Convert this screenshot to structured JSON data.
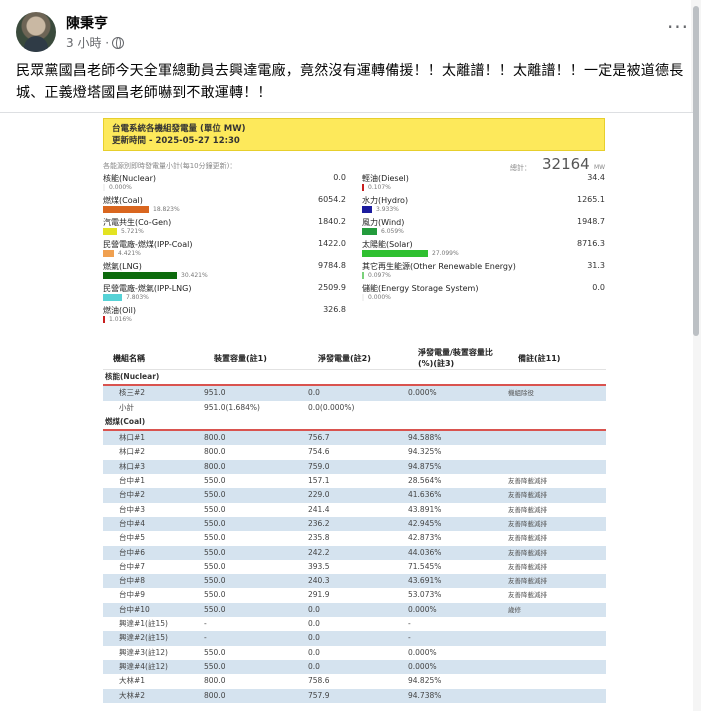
{
  "post": {
    "author": "陳秉亨",
    "time": "3 小時 ·",
    "more": "···",
    "text": "民眾黨國昌老師今天全軍總動員去興達電廠，竟然沒有運轉備援！！太離譜！！太離譜！！一定是被道德長城、正義燈塔國昌老師嚇到不敢運轉！！"
  },
  "report": {
    "title": "台電系統各機組發電量 (單位 MW)",
    "updated": "更新時間 - 2025-05-27 12:30",
    "summary_note": "各能源別即時發電量小計(每10分鐘更新)：",
    "total_label": "總計：",
    "total_value": "32164",
    "total_unit": "MW"
  },
  "sources": [
    {
      "name": "核能(Nuclear)",
      "value": "0.0",
      "pct": "0.000%",
      "fraction": 0.0,
      "color": "#f2f2f2"
    },
    {
      "name": "燃煤(Coal)",
      "value": "6054.2",
      "pct": "18.823%",
      "fraction": 0.18823,
      "color": "#d9661f"
    },
    {
      "name": "汽電共生(Co-Gen)",
      "value": "1840.2",
      "pct": "5.721%",
      "fraction": 0.05721,
      "color": "#e3e322"
    },
    {
      "name": "民營電廠-燃煤(IPP-Coal)",
      "value": "1422.0",
      "pct": "4.421%",
      "fraction": 0.04421,
      "color": "#f0a050"
    },
    {
      "name": "燃氣(LNG)",
      "value": "9784.8",
      "pct": "30.421%",
      "fraction": 0.30421,
      "color": "#0d6b0d"
    },
    {
      "name": "民營電廠-燃氣(IPP-LNG)",
      "value": "2509.9",
      "pct": "7.803%",
      "fraction": 0.07803,
      "color": "#56d2d6"
    },
    {
      "name": "燃油(Oil)",
      "value": "326.8",
      "pct": "1.016%",
      "fraction": 0.01016,
      "color": "#c81e1e"
    },
    {
      "name": "輕油(Diesel)",
      "value": "34.4",
      "pct": "0.107%",
      "fraction": 0.00107,
      "color": "#c81e1e"
    },
    {
      "name": "水力(Hydro)",
      "value": "1265.1",
      "pct": "3.933%",
      "fraction": 0.03933,
      "color": "#1c1c9e"
    },
    {
      "name": "風力(Wind)",
      "value": "1948.7",
      "pct": "6.059%",
      "fraction": 0.06059,
      "color": "#239b3c"
    },
    {
      "name": "太陽能(Solar)",
      "value": "8716.3",
      "pct": "27.099%",
      "fraction": 0.27099,
      "color": "#2fc030"
    },
    {
      "name": "其它再生能源(Other Renewable Energy)",
      "value": "31.3",
      "pct": "0.097%",
      "fraction": 0.00097,
      "color": "#7ad17a"
    },
    {
      "name": "儲能(Energy Storage System)",
      "value": "0.0",
      "pct": "0.000%",
      "fraction": 0.0,
      "color": "#f2f2f2"
    }
  ],
  "table": {
    "headers": [
      "機組名稱",
      "裝置容量(註1)",
      "淨發電量(註2)",
      "淨發電量/裝置容量比(%)(註3)",
      "備註(註11)"
    ],
    "rows": [
      {
        "group": "核能(Nuclear)"
      },
      {
        "c": [
          "核三#2",
          "951.0",
          "0.0",
          "0.000%",
          "機組除役"
        ]
      },
      {
        "c": [
          "小計",
          "951.0(1.684%)",
          "0.0(0.000%)",
          "",
          ""
        ]
      },
      {
        "group": "燃煤(Coal)"
      },
      {
        "c": [
          "林口#1",
          "800.0",
          "756.7",
          "94.588%",
          ""
        ]
      },
      {
        "c": [
          "林口#2",
          "800.0",
          "754.6",
          "94.325%",
          ""
        ]
      },
      {
        "c": [
          "林口#3",
          "800.0",
          "759.0",
          "94.875%",
          ""
        ]
      },
      {
        "c": [
          "台中#1",
          "550.0",
          "157.1",
          "28.564%",
          "友善降載減排"
        ]
      },
      {
        "c": [
          "台中#2",
          "550.0",
          "229.0",
          "41.636%",
          "友善降載減排"
        ]
      },
      {
        "c": [
          "台中#3",
          "550.0",
          "241.4",
          "43.891%",
          "友善降載減排"
        ]
      },
      {
        "c": [
          "台中#4",
          "550.0",
          "236.2",
          "42.945%",
          "友善降載減排"
        ]
      },
      {
        "c": [
          "台中#5",
          "550.0",
          "235.8",
          "42.873%",
          "友善降載減排"
        ]
      },
      {
        "c": [
          "台中#6",
          "550.0",
          "242.2",
          "44.036%",
          "友善降載減排"
        ]
      },
      {
        "c": [
          "台中#7",
          "550.0",
          "393.5",
          "71.545%",
          "友善降載減排"
        ]
      },
      {
        "c": [
          "台中#8",
          "550.0",
          "240.3",
          "43.691%",
          "友善降載減排"
        ]
      },
      {
        "c": [
          "台中#9",
          "550.0",
          "291.9",
          "53.073%",
          "友善降載減排"
        ]
      },
      {
        "c": [
          "台中#10",
          "550.0",
          "0.0",
          "0.000%",
          "歲修"
        ]
      },
      {
        "c": [
          "興達#1(註15)",
          "-",
          "0.0",
          "-",
          ""
        ]
      },
      {
        "c": [
          "興達#2(註15)",
          "-",
          "0.0",
          "-",
          ""
        ]
      },
      {
        "c": [
          "興達#3(註12)",
          "550.0",
          "0.0",
          "0.000%",
          ""
        ]
      },
      {
        "c": [
          "興達#4(註12)",
          "550.0",
          "0.0",
          "0.000%",
          ""
        ]
      },
      {
        "c": [
          "大林#1",
          "800.0",
          "758.6",
          "94.825%",
          ""
        ]
      },
      {
        "c": [
          "大林#2",
          "800.0",
          "757.9",
          "94.738%",
          ""
        ]
      }
    ]
  }
}
